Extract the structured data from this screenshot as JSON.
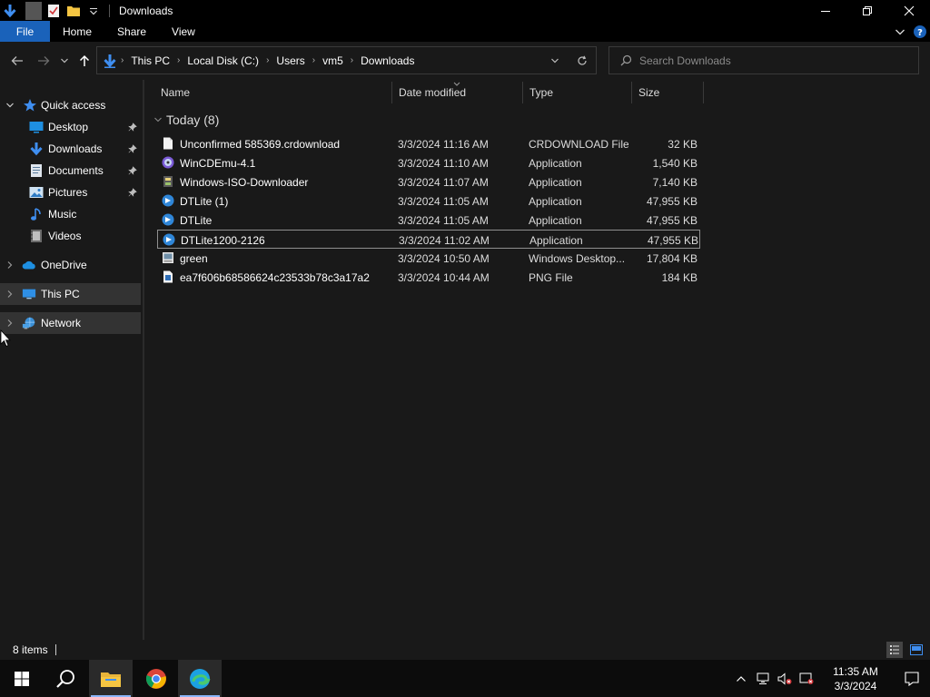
{
  "window": {
    "title": "Downloads"
  },
  "ribbon": {
    "tabs": [
      "File",
      "Home",
      "Share",
      "View"
    ]
  },
  "address": {
    "crumbs": [
      "This PC",
      "Local Disk (C:)",
      "Users",
      "vm5",
      "Downloads"
    ]
  },
  "search": {
    "placeholder": "Search Downloads"
  },
  "nav": {
    "quick_access": "Quick access",
    "items": [
      "Desktop",
      "Downloads",
      "Documents",
      "Pictures",
      "Music",
      "Videos"
    ],
    "onedrive": "OneDrive",
    "this_pc": "This PC",
    "network": "Network"
  },
  "columns": {
    "name": "Name",
    "date": "Date modified",
    "type": "Type",
    "size": "Size"
  },
  "group": {
    "label": "Today (8)"
  },
  "files": [
    {
      "name": "Unconfirmed 585369.crdownload",
      "date": "3/3/2024 11:16 AM",
      "type": "CRDOWNLOAD File",
      "size": "32 KB",
      "icon": "blank-file-icon"
    },
    {
      "name": "WinCDEmu-4.1",
      "date": "3/3/2024 11:10 AM",
      "type": "Application",
      "size": "1,540 KB",
      "icon": "wincdemu-icon"
    },
    {
      "name": "Windows-ISO-Downloader",
      "date": "3/3/2024 11:07 AM",
      "type": "Application",
      "size": "7,140 KB",
      "icon": "app-icon"
    },
    {
      "name": "DTLite (1)",
      "date": "3/3/2024 11:05 AM",
      "type": "Application",
      "size": "47,955 KB",
      "icon": "daemon-tools-icon"
    },
    {
      "name": "DTLite",
      "date": "3/3/2024 11:05 AM",
      "type": "Application",
      "size": "47,955 KB",
      "icon": "daemon-tools-icon"
    },
    {
      "name": "DTLite1200-2126",
      "date": "3/3/2024 11:02 AM",
      "type": "Application",
      "size": "47,955 KB",
      "icon": "daemon-tools-icon"
    },
    {
      "name": "green",
      "date": "3/3/2024 10:50 AM",
      "type": "Windows Desktop...",
      "size": "17,804 KB",
      "icon": "theme-file-icon"
    },
    {
      "name": "ea7f606b68586624c23533b78c3a17a2",
      "date": "3/3/2024 10:44 AM",
      "type": "PNG File",
      "size": "184 KB",
      "icon": "png-file-icon"
    }
  ],
  "status": {
    "count": "8 items"
  },
  "clock": {
    "time": "11:35 AM",
    "date": "3/3/2024"
  },
  "colors": {
    "accent": "#1a62ba",
    "background": "#191919",
    "taskbar": "#0c0c0c"
  }
}
